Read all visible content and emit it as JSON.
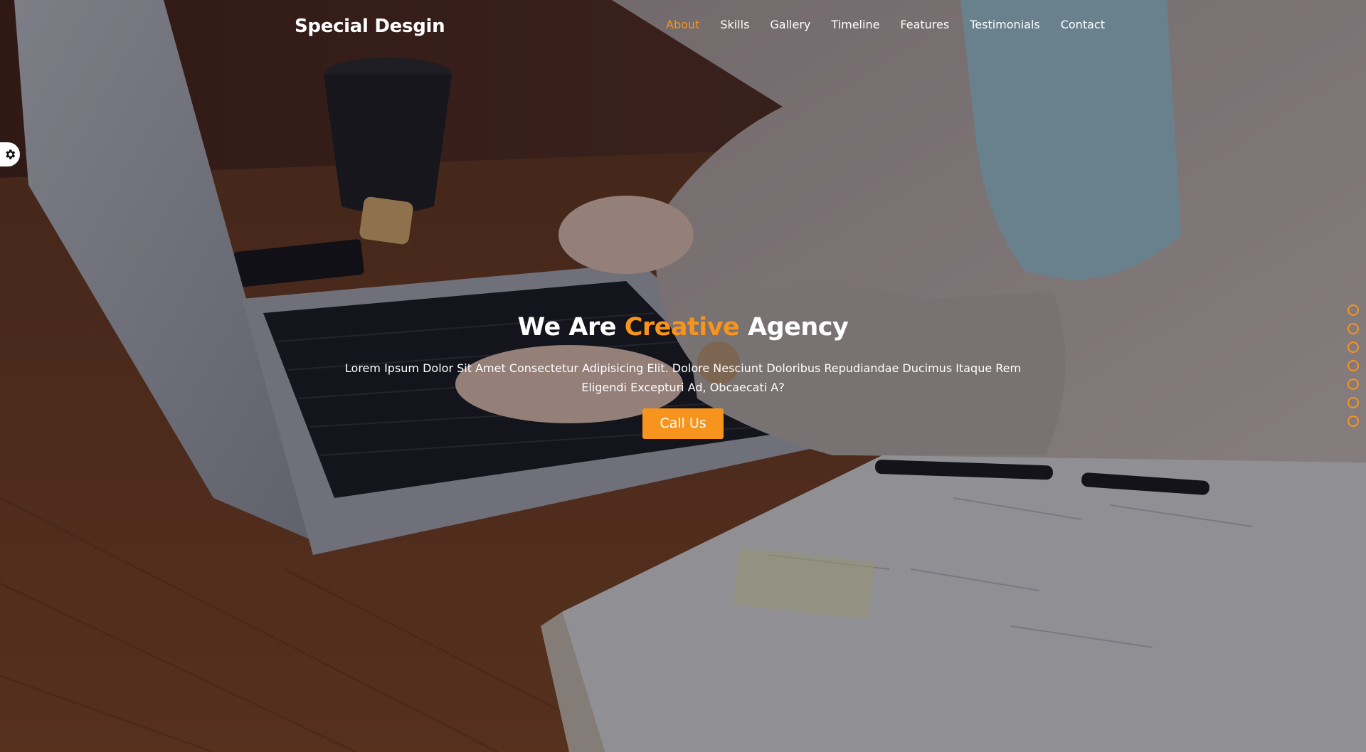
{
  "header": {
    "logo": "Special Desgin",
    "nav": [
      {
        "label": "About",
        "active": true
      },
      {
        "label": "Skills",
        "active": false
      },
      {
        "label": "Gallery",
        "active": false
      },
      {
        "label": "Timeline",
        "active": false
      },
      {
        "label": "Features",
        "active": false
      },
      {
        "label": "Testimonials",
        "active": false
      },
      {
        "label": "Contact",
        "active": false
      }
    ]
  },
  "hero": {
    "title_part1": "We Are ",
    "title_accent": "Creative",
    "title_part2": " Agency",
    "description": "Lorem Ipsum Dolor Sit Amet Consectetur Adipisicing Elit. Dolore Nesciunt Doloribus Repudiandae Ducimus Itaque Rem Eligendi Excepturi Ad, Obcaecati A?",
    "cta_label": "Call Us"
  },
  "settings_icon": "gear-icon",
  "bullets_count": 7,
  "colors": {
    "accent": "#f7941d",
    "text": "#ffffff"
  }
}
